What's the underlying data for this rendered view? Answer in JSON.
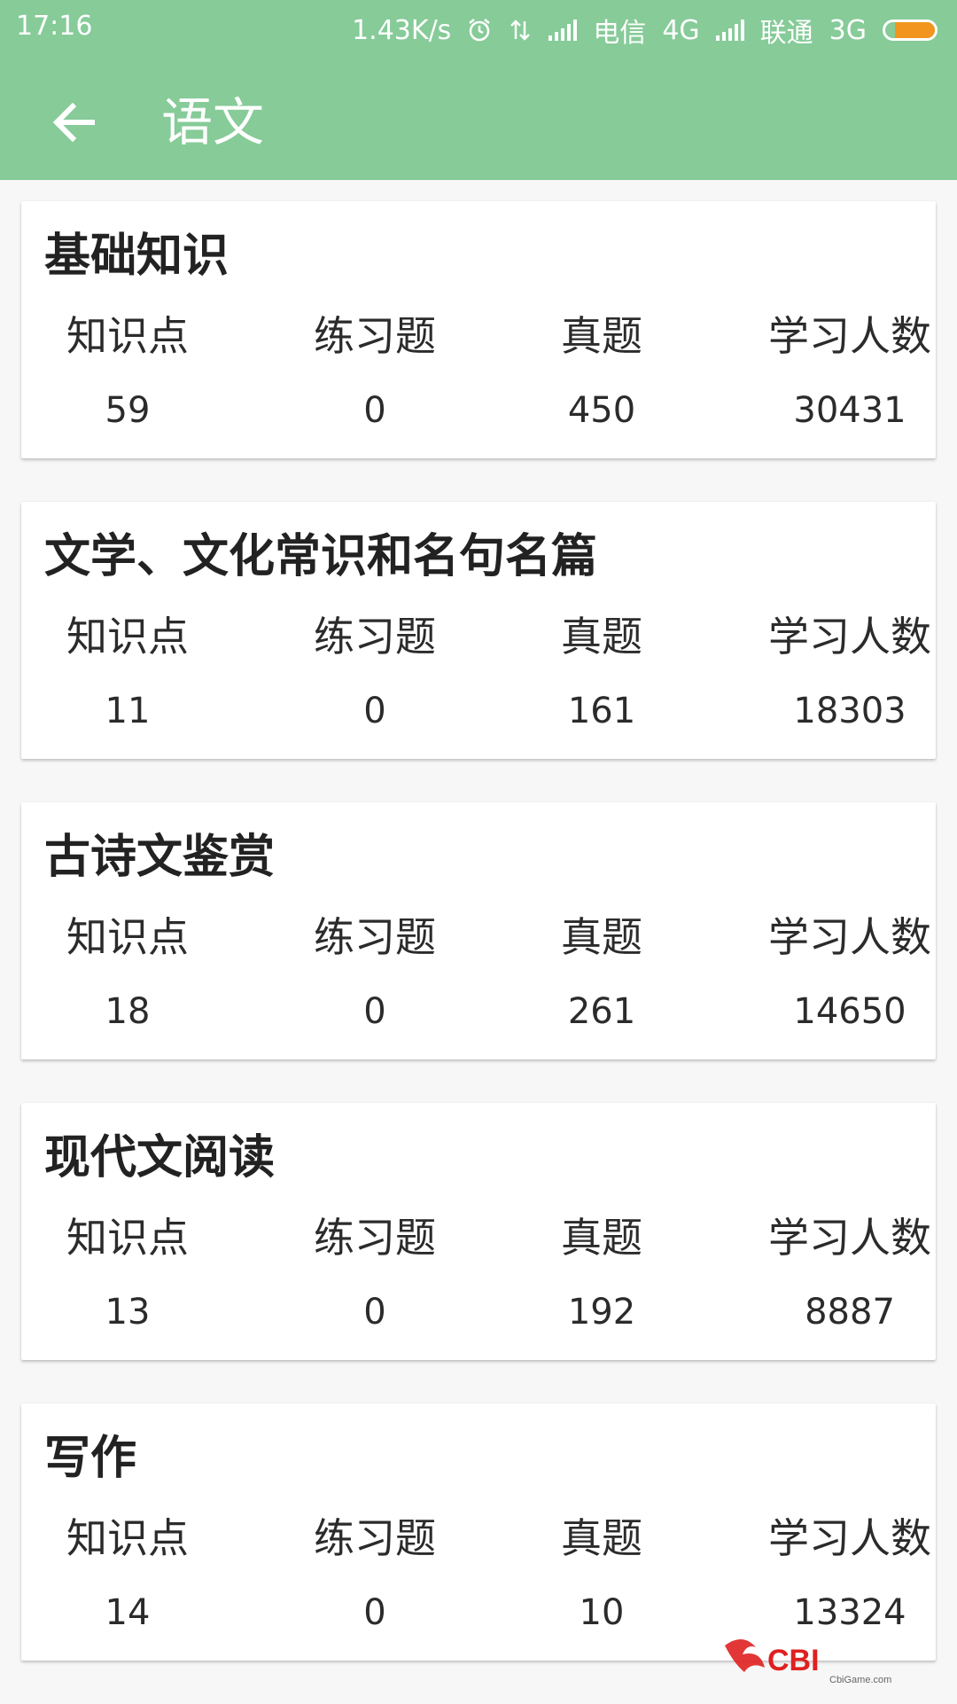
{
  "status": {
    "time": "17:16",
    "speed": "1.43K/s",
    "carrier1": "电信",
    "net1": "4G",
    "carrier2": "联通",
    "net2": "3G",
    "battery_level": 0.8,
    "battery_color": "#f2951e"
  },
  "toolbar": {
    "title": "语文",
    "back_icon": "arrow-left-icon",
    "bg_color": "#86cb98"
  },
  "columns": {
    "points": "知识点",
    "exercises": "练习题",
    "real_exams": "真题",
    "learners": "学习人数"
  },
  "cards": [
    {
      "title": "基础知识",
      "points": "59",
      "exercises": "0",
      "real_exams": "450",
      "learners": "30431"
    },
    {
      "title": "文学、文化常识和名句名篇",
      "points": "11",
      "exercises": "0",
      "real_exams": "161",
      "learners": "18303"
    },
    {
      "title": "古诗文鉴赏",
      "points": "18",
      "exercises": "0",
      "real_exams": "261",
      "learners": "14650"
    },
    {
      "title": "现代文阅读",
      "points": "13",
      "exercises": "0",
      "real_exams": "192",
      "learners": "8887"
    },
    {
      "title": "写作",
      "points": "14",
      "exercises": "0",
      "real_exams": "10",
      "learners": "13324"
    }
  ],
  "watermark": {
    "logo": "CBI",
    "site": "CbiGame.com"
  }
}
